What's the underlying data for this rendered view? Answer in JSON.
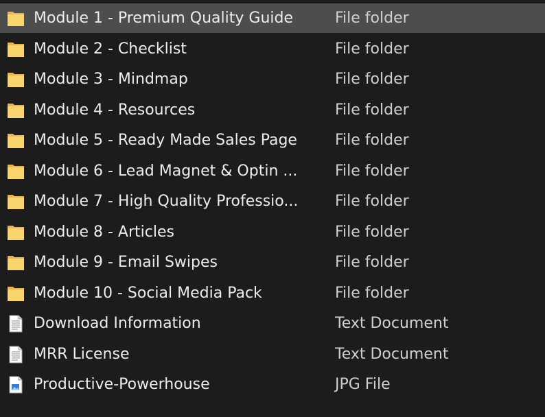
{
  "colors": {
    "background": "#1c1c1c",
    "selected_row": "#4d4d4d",
    "name_text": "#ececec",
    "type_text": "#d0d0d0",
    "folder_yellow": "#f7d46c"
  },
  "files": [
    {
      "name": "Module 1 - Premium Quality Guide",
      "type": "File folder",
      "icon": "folder-icon",
      "selected": true
    },
    {
      "name": "Module 2 - Checklist",
      "type": "File folder",
      "icon": "folder-icon",
      "selected": false
    },
    {
      "name": "Module 3 - Mindmap",
      "type": "File folder",
      "icon": "folder-icon",
      "selected": false
    },
    {
      "name": "Module 4 - Resources",
      "type": "File folder",
      "icon": "folder-icon",
      "selected": false
    },
    {
      "name": "Module 5 - Ready Made Sales Page",
      "type": "File folder",
      "icon": "folder-icon",
      "selected": false
    },
    {
      "name": "Module 6 - Lead Magnet & Optin ...",
      "type": "File folder",
      "icon": "folder-icon",
      "selected": false
    },
    {
      "name": "Module 7 - High Quality Professio...",
      "type": "File folder",
      "icon": "folder-icon",
      "selected": false
    },
    {
      "name": "Module 8 - Articles",
      "type": "File folder",
      "icon": "folder-icon",
      "selected": false
    },
    {
      "name": "Module 9 - Email Swipes",
      "type": "File folder",
      "icon": "folder-icon",
      "selected": false
    },
    {
      "name": "Module 10 - Social Media Pack",
      "type": "File folder",
      "icon": "folder-icon",
      "selected": false
    },
    {
      "name": "Download Information",
      "type": "Text Document",
      "icon": "text-document-icon",
      "selected": false
    },
    {
      "name": "MRR License",
      "type": "Text Document",
      "icon": "text-document-icon",
      "selected": false
    },
    {
      "name": "Productive-Powerhouse",
      "type": "JPG File",
      "icon": "image-file-icon",
      "selected": false
    }
  ]
}
